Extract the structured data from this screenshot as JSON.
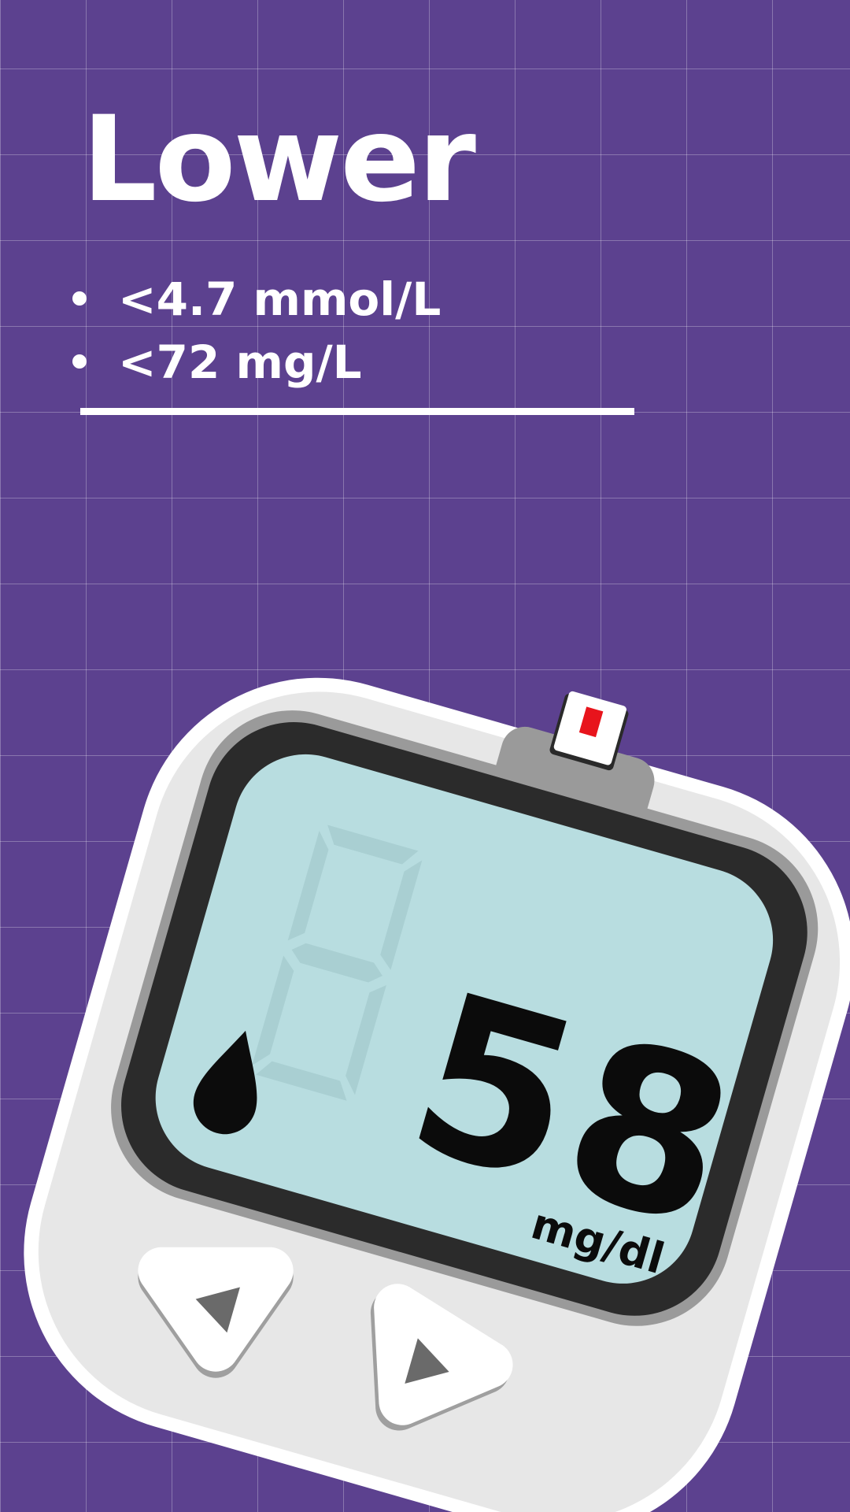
{
  "heading": "Lower",
  "ranges": [
    "<4.7 mmol/L",
    "<72 mg/L"
  ],
  "meter": {
    "value": "58",
    "unit": "mg/dl"
  },
  "colors": {
    "background": "#5c418f",
    "text": "#ffffff",
    "screen": "#b8dde0",
    "strip_mark": "#e8141c"
  },
  "icons": [
    "blood-drop-icon",
    "left-arrow-icon",
    "right-arrow-icon"
  ]
}
